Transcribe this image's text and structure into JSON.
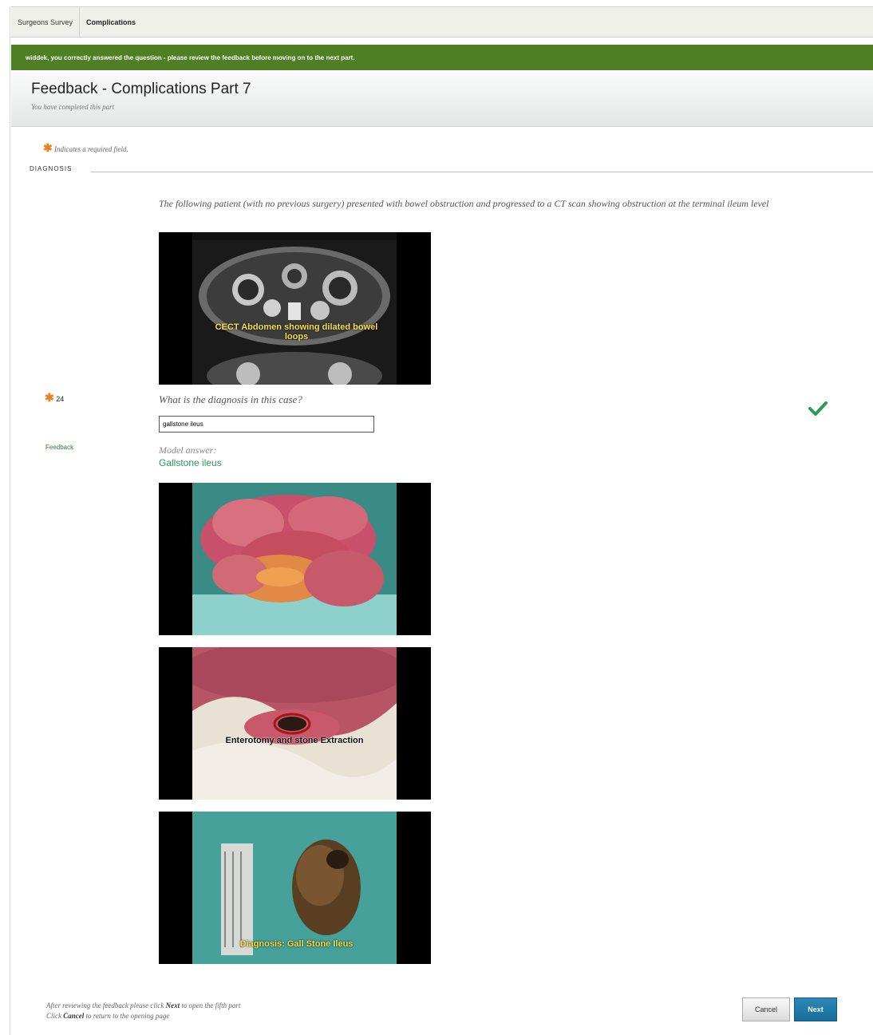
{
  "breadcrumb": {
    "items": [
      "Surgeons Survey",
      "Complications"
    ]
  },
  "success_message": "widdek, you correctly answered the question - please review the feedback before moving on to the next part.",
  "header": {
    "title": "Feedback - Complications Part 7",
    "subtitle": "You have completed this part"
  },
  "required_note": "Indicates a required field.",
  "section_label": "DIAGNOSIS",
  "intro_text": "The following patient (with no previous surgery) presented with bowel obstruction and progressed to a CT scan showing obstruction at the terminal ileum level",
  "images": [
    {
      "caption": "CECT Abdomen showing dilated bowel loops"
    },
    {
      "caption": ""
    },
    {
      "caption": "Enterotomy and stone Extraction"
    },
    {
      "caption": "Diagnosis: Gall Stone Ileus"
    }
  ],
  "question": {
    "number": "24",
    "text": "What is the diagnosis in this case?",
    "answer_value": "gallstone ileus",
    "status": "correct"
  },
  "feedback": {
    "label": "Feedback",
    "model_label": "Model answer:",
    "model_answer": "Gallstone ileus"
  },
  "footer": {
    "line1_pre": "After reviewing the feedback please click ",
    "line1_bold": "Next",
    "line1_post": " to open the fifth part",
    "line2_pre": "Click ",
    "line2_bold": "Cancel",
    "line2_post": " to return to the opening page"
  },
  "buttons": {
    "cancel": "Cancel",
    "next": "Next"
  },
  "colors": {
    "success": "#4e7f23",
    "accent_green": "#2e9a57",
    "primary": "#1e7aab",
    "required": "#e8801c"
  },
  "icons": {
    "required": "asterisk-icon",
    "correct": "checkmark-icon"
  }
}
